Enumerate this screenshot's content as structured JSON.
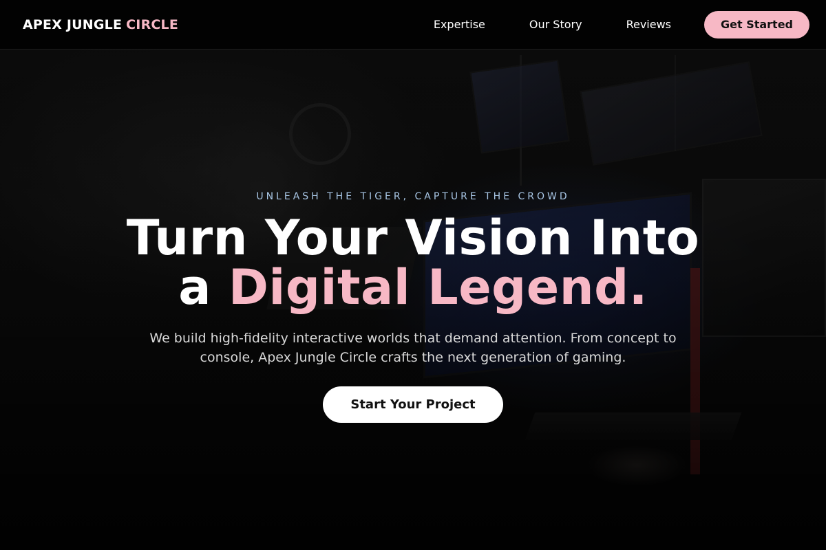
{
  "brand": {
    "name_part1": "APEX JUNGLE",
    "name_part2": "CIRCLE"
  },
  "nav": {
    "links": [
      {
        "label": "Expertise"
      },
      {
        "label": "Our Story"
      },
      {
        "label": "Reviews"
      }
    ],
    "cta_label": "Get Started"
  },
  "hero": {
    "eyebrow": "UNLEASH THE TIGER, CAPTURE THE CROWD",
    "title_line1": "Turn Your Vision Into",
    "title_line2_prefix": "a",
    "title_line2_accent": "Digital Legend.",
    "subtitle": "We build high-fidelity interactive worlds that demand attention. From concept to console, Apex Jungle Circle crafts the next generation of gaming.",
    "button_label": "Start Your Project"
  },
  "colors": {
    "accent_pink": "#f7b8c5",
    "eyebrow_blue": "#a9c7e6",
    "background": "#070707"
  }
}
